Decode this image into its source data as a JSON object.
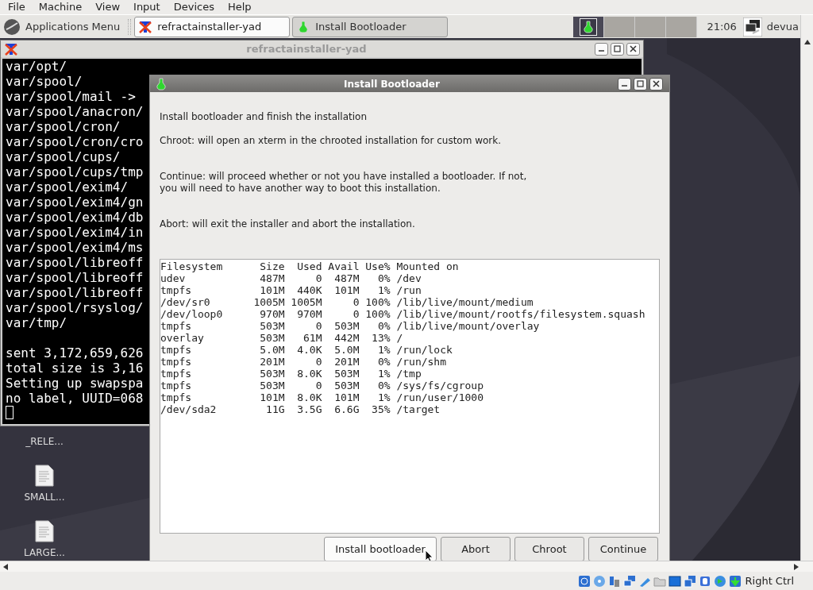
{
  "menu_bar": [
    "File",
    "Machine",
    "View",
    "Input",
    "Devices",
    "Help"
  ],
  "panel": {
    "app_menu": "Applications Menu",
    "tasks": [
      {
        "label": "refractainstaller-yad",
        "kind": "terminal",
        "selected": false
      },
      {
        "label": "Install Bootloader",
        "kind": "flask",
        "selected": true
      }
    ],
    "workspaces": [
      {
        "selected": true
      },
      {
        "selected": false
      },
      {
        "selected": false
      },
      {
        "selected": false
      }
    ],
    "clock": "21:06",
    "user": "devua"
  },
  "terminal": {
    "title": "refractainstaller-yad",
    "lines": [
      "var/opt/",
      "var/spool/",
      "var/spool/mail ->",
      "var/spool/anacron/",
      "var/spool/cron/",
      "var/spool/cron/cro",
      "var/spool/cups/",
      "var/spool/cups/tmp",
      "var/spool/exim4/",
      "var/spool/exim4/gn",
      "var/spool/exim4/db",
      "var/spool/exim4/in",
      "var/spool/exim4/ms",
      "var/spool/libreoff",
      "var/spool/libreoff",
      "var/spool/libreoff",
      "var/spool/rsyslog/",
      "var/tmp/"
    ],
    "summary_lines": [
      "sent 3,172,659,626",
      "total size is 3,16",
      "Setting up swapspa",
      "no label, UUID=068"
    ]
  },
  "desktop_icons": [
    {
      "label": "_RELE...",
      "kind": "hidden"
    },
    {
      "label": "SMALL...",
      "kind": "document"
    },
    {
      "label": "LARGE...",
      "kind": "document"
    }
  ],
  "dialog": {
    "title": "Install Bootloader",
    "paragraphs": [
      "Install bootloader and finish the installation",
      "Chroot: will open an xterm in the chrooted installation for custom work.",
      "Continue: will proceed whether or not you have installed a bootloader. If not,\nyou will need to have another way to boot this installation.",
      "Abort: will exit the installer and abort the installation."
    ],
    "output_lines": [
      "Filesystem      Size  Used Avail Use% Mounted on",
      "udev            487M     0  487M   0% /dev",
      "tmpfs           101M  440K  101M   1% /run",
      "/dev/sr0       1005M 1005M     0 100% /lib/live/mount/medium",
      "/dev/loop0      970M  970M     0 100% /lib/live/mount/rootfs/filesystem.squash",
      "tmpfs           503M     0  503M   0% /lib/live/mount/overlay",
      "overlay         503M   61M  442M  13% /",
      "tmpfs           5.0M  4.0K  5.0M   1% /run/lock",
      "tmpfs           201M     0  201M   0% /run/shm",
      "tmpfs           503M  8.0K  503M   1% /tmp",
      "tmpfs           503M     0  503M   0% /sys/fs/cgroup",
      "tmpfs           101M  8.0K  101M   1% /run/user/1000",
      "/dev/sda2        11G  3.5G  6.6G  35% /target"
    ],
    "buttons": [
      {
        "label": "Install bootloader",
        "hovered": true
      },
      {
        "label": "Abort",
        "hovered": false
      },
      {
        "label": "Chroot",
        "hovered": false
      },
      {
        "label": "Continue",
        "hovered": false
      }
    ]
  },
  "status_bar": {
    "host_key": "Right Ctrl"
  }
}
